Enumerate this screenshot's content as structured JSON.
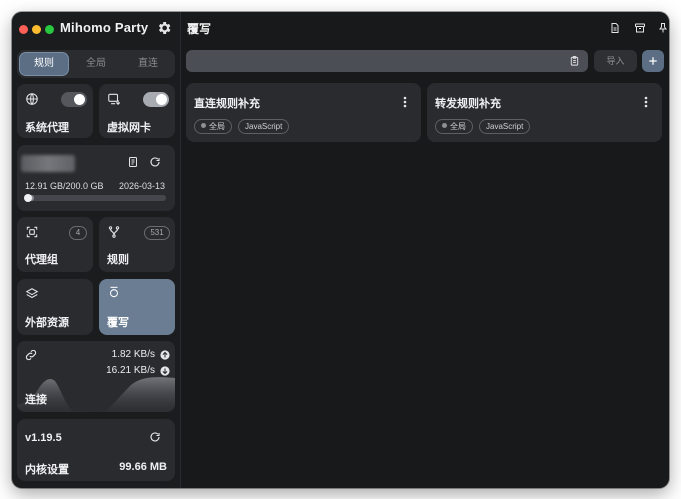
{
  "app": {
    "title": "Mihomo Party"
  },
  "sidebar": {
    "modes": [
      {
        "label": "规则",
        "active": true
      },
      {
        "label": "全局",
        "active": false
      },
      {
        "label": "直连",
        "active": false
      }
    ],
    "system_proxy": {
      "label": "系统代理",
      "icon": "globe-icon",
      "enabled": true
    },
    "tun": {
      "label": "虚拟网卡",
      "icon": "tun-device-icon",
      "enabled": true
    },
    "profile": {
      "usage": "12.91 GB/200.0 GB",
      "expiry": "2026-03-13",
      "usage_fraction": 0.0645
    },
    "proxy_groups": {
      "label": "代理组",
      "count": "4"
    },
    "rules": {
      "label": "规则",
      "count": "531"
    },
    "resources": {
      "label": "外部资源"
    },
    "override": {
      "label": "覆写",
      "selected": true
    },
    "connections": {
      "label": "连接",
      "upload": "1.82 KB/s",
      "download": "16.21 KB/s"
    },
    "core": {
      "version": "v1.19.5",
      "label": "内核设置",
      "memory": "99.66 MB"
    }
  },
  "main": {
    "title": "覆写",
    "url_input": {
      "value": "",
      "placeholder": ""
    },
    "import_label": "导入",
    "cards": [
      {
        "title": "直连规则补充",
        "tags": [
          "全局",
          "JavaScript"
        ]
      },
      {
        "title": "转发规则补充",
        "tags": [
          "全局",
          "JavaScript"
        ]
      }
    ]
  },
  "colors": {
    "accent": "#5b6e84",
    "window_bg": "#18191b",
    "card_bg": "#2a2b2f",
    "selected_card": "#6b7d92"
  }
}
